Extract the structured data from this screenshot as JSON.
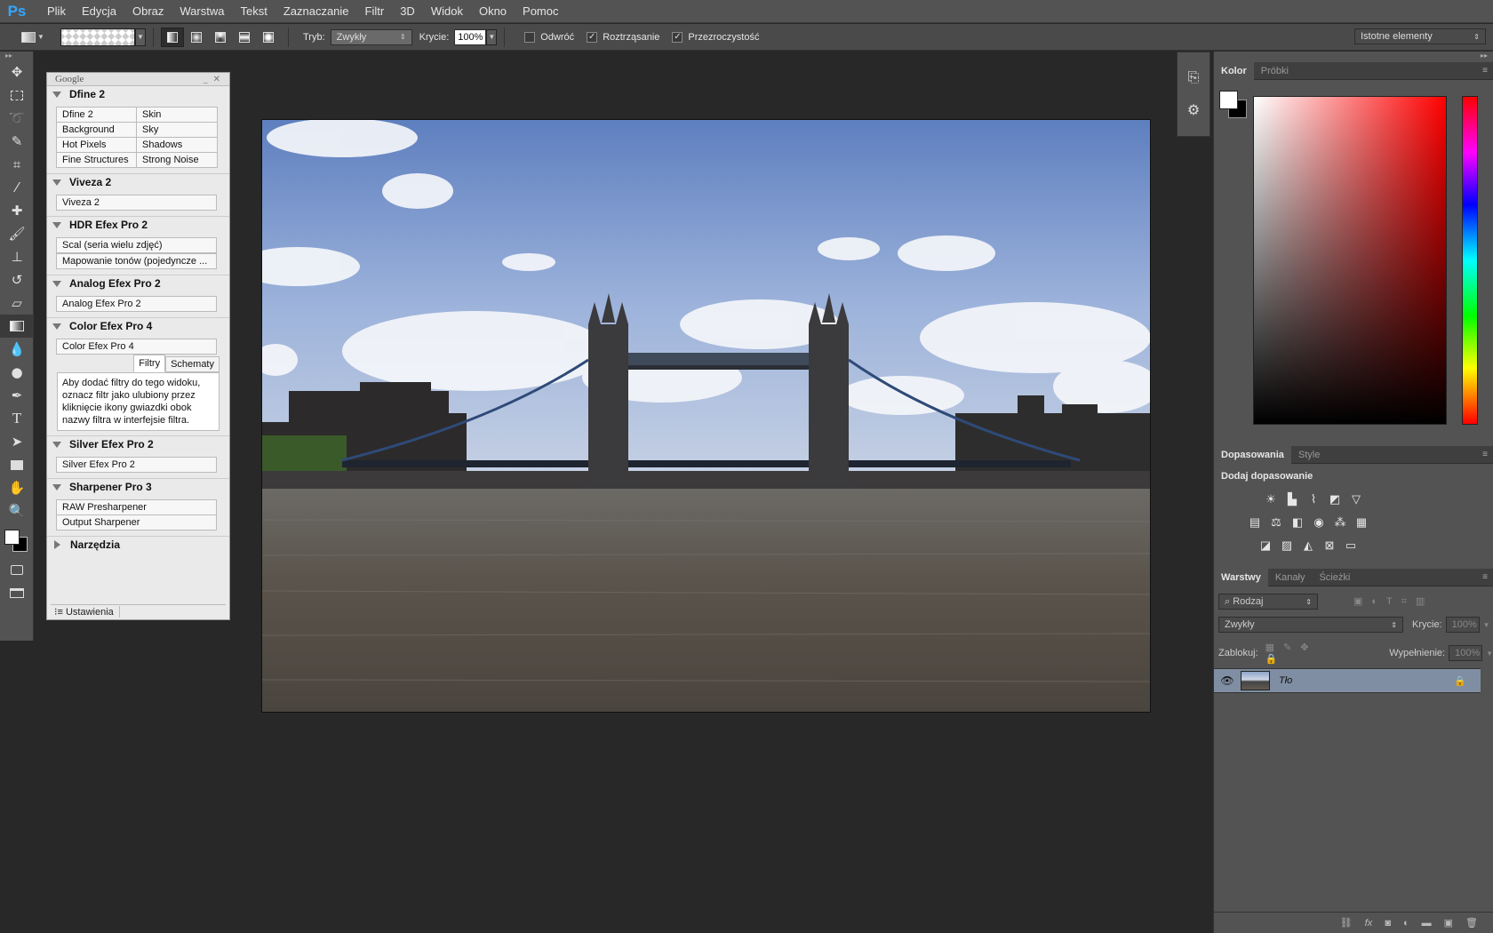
{
  "app": {
    "logo": "Ps"
  },
  "menu": [
    "Plik",
    "Edycja",
    "Obraz",
    "Warstwa",
    "Tekst",
    "Zaznaczanie",
    "Filtr",
    "3D",
    "Widok",
    "Okno",
    "Pomoc"
  ],
  "options": {
    "mode_label": "Tryb:",
    "mode_value": "Zwykły",
    "opacity_label": "Krycie:",
    "opacity_value": "100%",
    "reverse_label": "Odwróć",
    "dither_label": "Roztrząsanie",
    "transparency_label": "Przezroczystość",
    "workspace_value": "Istotne elementy"
  },
  "google_panel": {
    "title": "Google",
    "dfine": {
      "header": "Dfine 2",
      "buttons": [
        "Dfine 2",
        "Skin",
        "Background",
        "Sky",
        "Hot Pixels",
        "Shadows",
        "Fine Structures",
        "Strong Noise"
      ]
    },
    "viveza": {
      "header": "Viveza 2",
      "button": "Viveza 2"
    },
    "hdr": {
      "header": "HDR Efex Pro 2",
      "buttons": [
        "Scal (seria wielu zdjęć)",
        "Mapowanie tonów (pojedyncze ..."
      ]
    },
    "analog": {
      "header": "Analog Efex Pro 2",
      "button": "Analog Efex Pro 2"
    },
    "color": {
      "header": "Color Efex Pro 4",
      "button": "Color Efex Pro 4",
      "tab_filters": "Filtry",
      "tab_recipes": "Schematy",
      "info": "Aby dodać filtry do tego widoku, oznacz filtr jako ulubiony przez kliknięcie ikony gwiazdki obok nazwy filtra w interfejsie filtra."
    },
    "silver": {
      "header": "Silver Efex Pro 2",
      "button": "Silver Efex Pro 2"
    },
    "sharpener": {
      "header": "Sharpener Pro 3",
      "buttons": [
        "RAW Presharpener",
        "Output Sharpener"
      ]
    },
    "tools": {
      "header": "Narzędzia"
    },
    "footer": {
      "settings": "Ustawienia"
    }
  },
  "color_panel": {
    "tabs": [
      "Kolor",
      "Próbki"
    ]
  },
  "adjust_panel": {
    "tabs": [
      "Dopasowania",
      "Style"
    ],
    "title": "Dodaj dopasowanie"
  },
  "layers_panel": {
    "tabs": [
      "Warstwy",
      "Kanały",
      "Ścieżki"
    ],
    "filter_value": "Rodzaj",
    "blend_value": "Zwykły",
    "opacity_label": "Krycie:",
    "opacity_value": "100%",
    "lock_label": "Zablokuj:",
    "fill_label": "Wypełnienie:",
    "fill_value": "100%",
    "layer_name": "Tło"
  },
  "colors": {
    "accent": "#31a8ff",
    "layer_selected": "#7f8ea2"
  }
}
